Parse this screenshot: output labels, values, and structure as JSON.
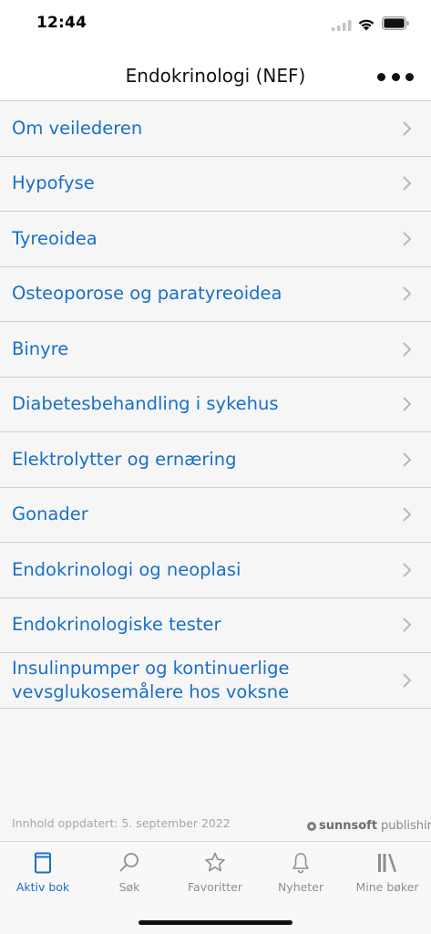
{
  "status": {
    "time": "12:44"
  },
  "nav": {
    "title": "Endokrinologi (NEF)"
  },
  "items": [
    {
      "label": "Om veilederen"
    },
    {
      "label": "Hypofyse"
    },
    {
      "label": "Tyreoidea"
    },
    {
      "label": "Osteoporose og paratyreoidea"
    },
    {
      "label": "Binyre"
    },
    {
      "label": "Diabetesbehandling i sykehus"
    },
    {
      "label": "Elektrolytter og ernæring"
    },
    {
      "label": "Gonader"
    },
    {
      "label": "Endokrinologi og neoplasi"
    },
    {
      "label": "Endokrinologiske tester"
    },
    {
      "label": "Insulinpumper og kontinuerlige\nvevsglukosemålere hos voksne"
    }
  ],
  "footer": {
    "updated": "Innhold oppdatert: 5. september 2022",
    "brand_strong": "sunnsoft",
    "brand_light": "publishing"
  },
  "tabs": [
    {
      "label": "Aktiv bok",
      "icon": "book-icon",
      "active": true
    },
    {
      "label": "Søk",
      "icon": "search-icon",
      "active": false
    },
    {
      "label": "Favoritter",
      "icon": "star-icon",
      "active": false
    },
    {
      "label": "Nyheter",
      "icon": "bell-icon",
      "active": false
    },
    {
      "label": "Mine bøker",
      "icon": "library-icon",
      "active": false
    }
  ],
  "colors": {
    "accent": "#1a6fc7",
    "inactive": "#8e8e93",
    "background": "#f6f6f6"
  }
}
